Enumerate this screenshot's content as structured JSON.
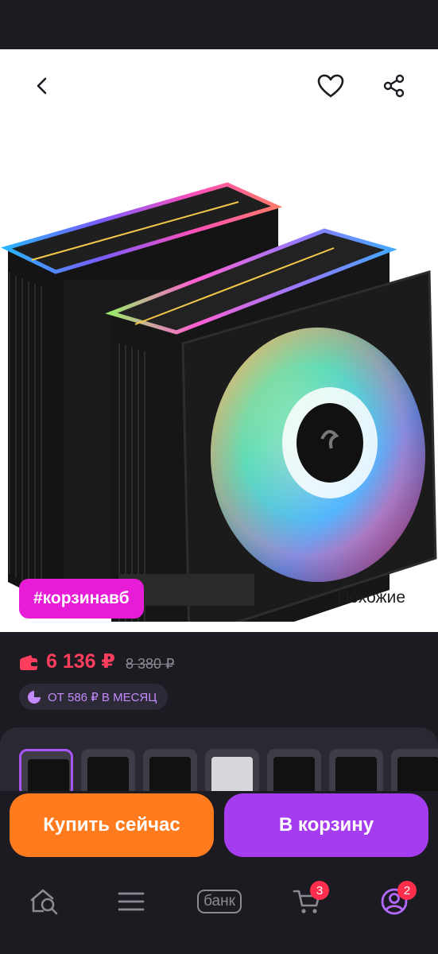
{
  "tag_chip": "#корзинавб",
  "similar_label": "Похожие",
  "price": {
    "current": "6 136 ₽",
    "old": "8 380 ₽",
    "installment": "ОТ 586 ₽ В МЕСЯЦ"
  },
  "buttons": {
    "buy_now": "Купить сейчас",
    "add_to_cart": "В корзину"
  },
  "nav": {
    "bank_label": "банк",
    "cart_badge": "3",
    "profile_badge": "2"
  },
  "colors": {
    "tag_chip": "#e71cd6",
    "price_current": "#ff3d5c",
    "buy_now": "#ff7b1e",
    "add_to_cart": "#a53cf0",
    "badge": "#ff2e4d"
  },
  "icons": [
    "back-arrow-icon",
    "heart-icon",
    "share-icon",
    "wallet-icon",
    "pie-chart-icon",
    "home-search-icon",
    "menu-icon",
    "cart-icon",
    "profile-icon"
  ]
}
